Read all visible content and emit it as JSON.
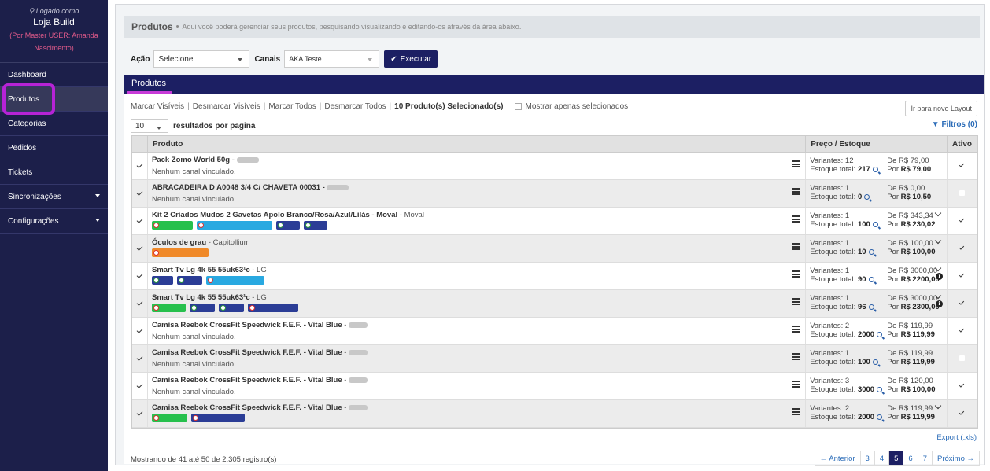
{
  "sidebar": {
    "logged_as": "Logado como",
    "store": "Loja Build",
    "master_line1": "(Por Master USER: Amanda",
    "master_line2": "Nascimento)",
    "items": [
      {
        "label": "Dashboard"
      },
      {
        "label": "Produtos"
      },
      {
        "label": "Categorias"
      },
      {
        "label": "Pedidos"
      },
      {
        "label": "Tickets"
      },
      {
        "label": "Sincronizações"
      },
      {
        "label": "Configurações"
      }
    ]
  },
  "header": {
    "title": "Produtos",
    "subtitle": "Aqui você poderá gerenciar seus produtos, pesquisando visualizando e editando-os através da área abaixo."
  },
  "actions": {
    "action_label": "Ação",
    "action_value": "Selecione",
    "channels_label": "Canais",
    "channels_value": "AKA Teste",
    "execute_label": "Executar"
  },
  "panel": {
    "title": "Produtos",
    "mark_visible": "Marcar Visíveis",
    "unmark_visible": "Desmarcar Visíveis",
    "mark_all": "Marcar Todos",
    "unmark_all": "Desmarcar Todos",
    "selected_count": "10 Produto(s) Selecionado(s)",
    "show_selected": "Mostrar apenas selecionados",
    "new_layout": "Ir para novo Layout",
    "per_page_value": "10",
    "per_page_label": "resultados por pagina",
    "filters": "Filtros (0)"
  },
  "table": {
    "headers": {
      "product": "Produto",
      "price": "Preço / Estoque",
      "active": "Ativo"
    },
    "rows": [
      {
        "name": "Pack Zomo World 50g -",
        "brand": "",
        "sub": "Nenhum canal vinculado.",
        "variants": "Variantes: 12",
        "stock_label": "Estoque total:",
        "stock": "217",
        "de": "De R$ 79,00",
        "por_label": "Por",
        "por": "R$ 79,00"
      },
      {
        "name": "ABRACADEIRA D A0048 3/4 C/ CHAVETA 00031 -",
        "brand": "",
        "sub": "Nenhum canal vinculado.",
        "variants": "Variantes: 1",
        "stock_label": "Estoque total:",
        "stock": "0",
        "de": "De R$ 0,00",
        "por_label": "Por",
        "por": "R$ 10,50"
      },
      {
        "name": "Kit 2 Criados Mudos 2 Gavetas Apolo Branco/Rosa/Azul/Lilás - Moval",
        "brand": "- Moval",
        "sub": "",
        "variants": "Variantes: 1",
        "stock_label": "Estoque total:",
        "stock": "100",
        "de": "De R$ 343,34",
        "por_label": "Por",
        "por": "R$ 230,02"
      },
      {
        "name": "Óculos de grau",
        "brand": "- Capitollium",
        "sub": "",
        "variants": "Variantes: 1",
        "stock_label": "Estoque total:",
        "stock": "10",
        "de": "De R$ 100,00",
        "por_label": "Por",
        "por": "R$ 100,00"
      },
      {
        "name": "Smart Tv Lg 4k 55 55uk63¹c",
        "brand": "- LG",
        "sub": "",
        "variants": "Variantes: 1",
        "stock_label": "Estoque total:",
        "stock": "90",
        "de": "De R$ 3000,00",
        "por_label": "Por",
        "por": "R$ 2200,00"
      },
      {
        "name": "Smart Tv Lg 4k 55 55uk63¹c",
        "brand": "- LG",
        "sub": "",
        "variants": "Variantes: 1",
        "stock_label": "Estoque total:",
        "stock": "96",
        "de": "De R$ 3000,00",
        "por_label": "Por",
        "por": "R$ 2300,00"
      },
      {
        "name": "Camisa Reebok CrossFit Speedwick F.E.F. - Vital Blue",
        "brand": "-",
        "sub": "Nenhum canal vinculado.",
        "variants": "Variantes: 2",
        "stock_label": "Estoque total:",
        "stock": "2000",
        "de": "De R$ 119,99",
        "por_label": "Por",
        "por": "R$ 119,99"
      },
      {
        "name": "Camisa Reebok CrossFit Speedwick F.E.F. - Vital Blue",
        "brand": "-",
        "sub": "Nenhum canal vinculado.",
        "variants": "Variantes: 1",
        "stock_label": "Estoque total:",
        "stock": "100",
        "de": "De R$ 119,99",
        "por_label": "Por",
        "por": "R$ 119,99"
      },
      {
        "name": "Camisa Reebok CrossFit Speedwick F.E.F. - Vital Blue",
        "brand": "-",
        "sub": "Nenhum canal vinculado.",
        "variants": "Variantes: 3",
        "stock_label": "Estoque total:",
        "stock": "3000",
        "de": "De R$ 120,00",
        "por_label": "Por",
        "por": "R$ 100,00"
      },
      {
        "name": "Camisa Reebok CrossFit Speedwick F.E.F. - Vital Blue",
        "brand": "-",
        "sub": "",
        "variants": "Variantes: 2",
        "stock_label": "Estoque total:",
        "stock": "2000",
        "de": "De R$ 119,99",
        "por_label": "Por",
        "por": "R$ 119,99"
      }
    ]
  },
  "footer": {
    "export": "Export (.xls)",
    "showing": "Mostrando de 41 até 50 de 2.305 registro(s)",
    "prev": "← Anterior",
    "pages": [
      "3",
      "4",
      "5",
      "6",
      "7"
    ],
    "current_page": "5",
    "next": "Próximo →"
  }
}
